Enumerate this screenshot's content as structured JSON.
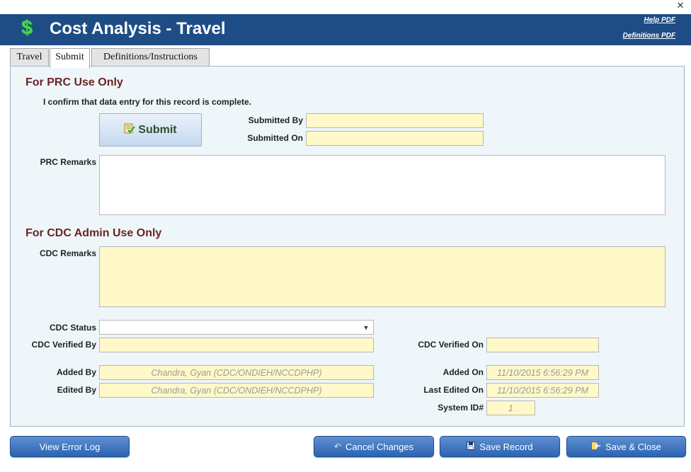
{
  "window": {
    "close_glyph": "✕"
  },
  "header": {
    "icon": "$",
    "title": "Cost Analysis - Travel",
    "links": [
      "Help PDF",
      "Definitions PDF"
    ]
  },
  "tabs": [
    {
      "label": "Travel",
      "active": false
    },
    {
      "label": "Submit",
      "active": true
    },
    {
      "label": "Definitions/Instructions",
      "active": false
    }
  ],
  "prc": {
    "heading": "For PRC Use Only",
    "confirm_text": "I confirm that data entry for this record is complete.",
    "submit_label": "Submit",
    "submitted_by_label": "Submitted By",
    "submitted_by_value": "",
    "submitted_on_label": "Submitted On",
    "submitted_on_value": "",
    "remarks_label": "PRC Remarks",
    "remarks_value": ""
  },
  "cdc": {
    "heading": "For CDC Admin Use Only",
    "remarks_label": "CDC Remarks",
    "remarks_value": "",
    "status_label": "CDC Status",
    "status_value": "",
    "verified_by_label": "CDC Verified By",
    "verified_by_value": "",
    "verified_on_label": "CDC Verified On",
    "verified_on_value": ""
  },
  "audit": {
    "added_by_label": "Added By",
    "added_by_value": "Chandra, Gyan (CDC/ONDIEH/NCCDPHP)",
    "edited_by_label": "Edited By",
    "edited_by_value": "Chandra, Gyan (CDC/ONDIEH/NCCDPHP)",
    "added_on_label": "Added On",
    "added_on_value": "11/10/2015 6:56:29 PM",
    "last_edited_on_label": "Last Edited On",
    "last_edited_on_value": "11/10/2015 6:56:29 PM",
    "system_id_label": "System ID#",
    "system_id_value": "1"
  },
  "footer": {
    "view_error_log": "View Error Log",
    "cancel_changes": "Cancel Changes",
    "save_record": "Save Record",
    "save_close": "Save & Close"
  },
  "colors": {
    "header_bg": "#1e4d86",
    "field_yellow": "#fff9c9",
    "panel_bg": "#eef6fa",
    "section_heading": "#6b2424",
    "button_blue": "#2c64b1"
  }
}
